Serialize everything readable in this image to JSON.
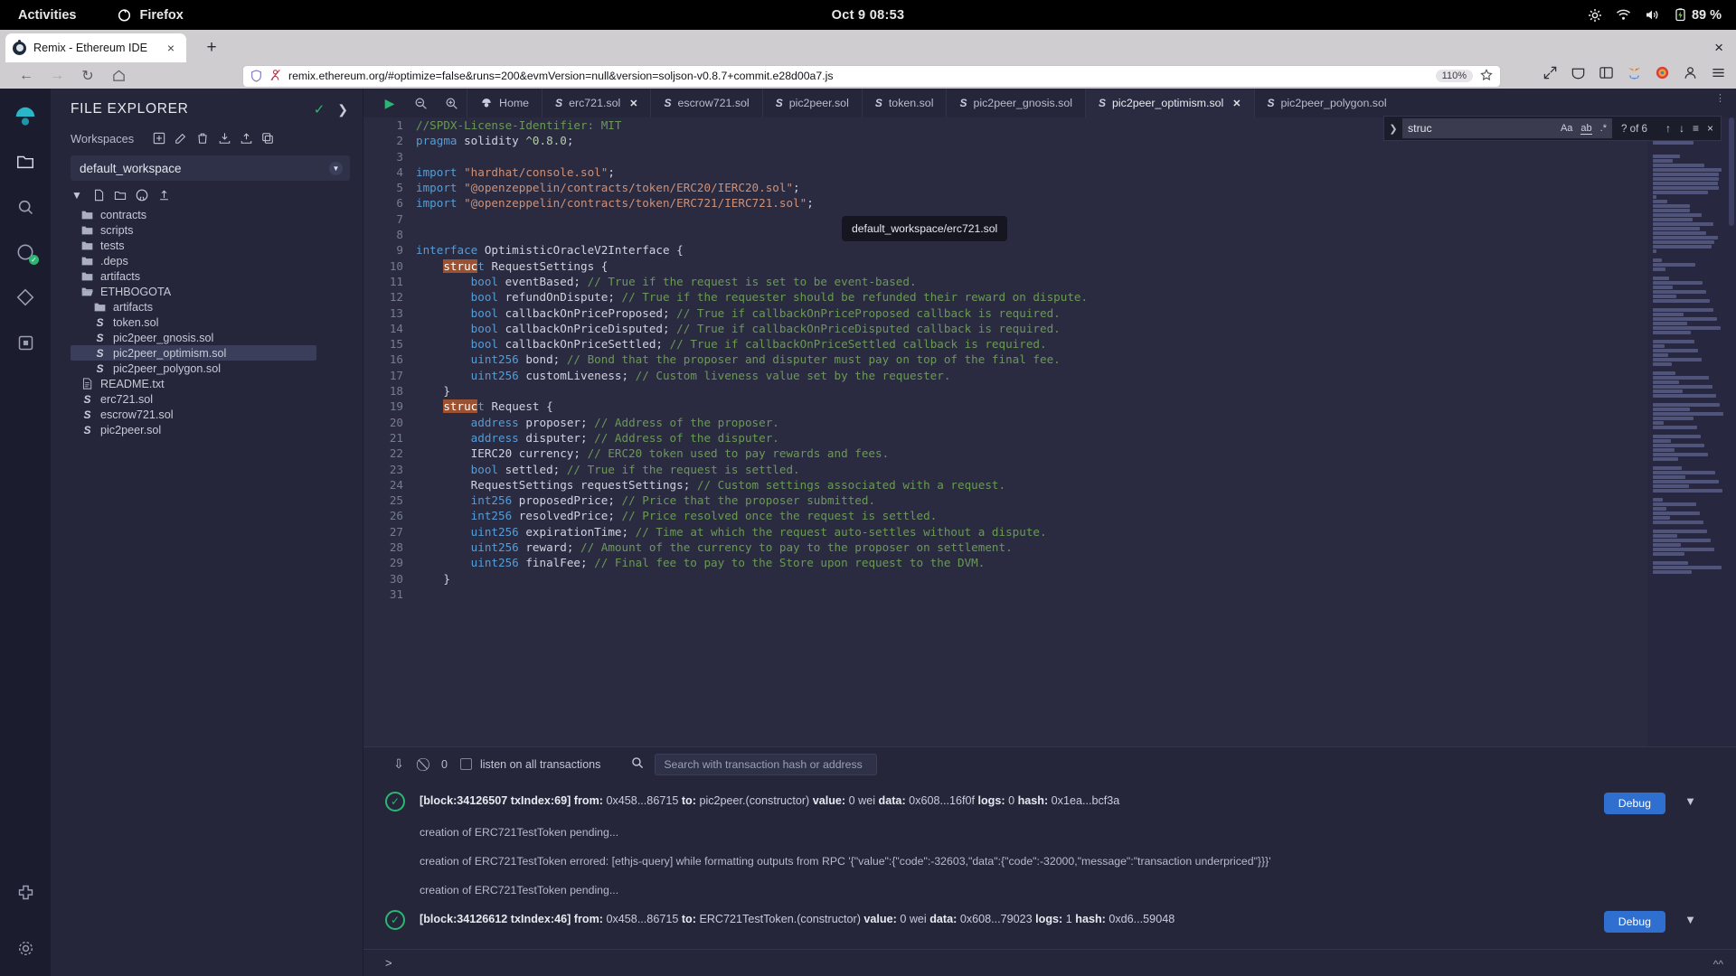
{
  "gnome": {
    "activities": "Activities",
    "app_name": "Firefox",
    "clock": "Oct 9  08:53",
    "battery": "89 %",
    "icons": [
      "settings-icon",
      "wifi-icon",
      "volume-icon",
      "battery-icon"
    ]
  },
  "browser": {
    "tab_title": "Remix - Ethereum IDE",
    "tab_close": "×",
    "new_tab": "+",
    "window_close": "×",
    "url": "remix.ethereum.org/#optimize=false&runs=200&evmVersion=null&version=soljson-v0.8.7+commit.e28d00a7.js",
    "zoom_level": "110%",
    "nav": {
      "back": "←",
      "forward": "→",
      "reload": "↻",
      "home": "⌂"
    }
  },
  "rail": {
    "items": [
      {
        "name": "remix-logo-icon",
        "glyph": "◉"
      },
      {
        "name": "file-explorer-icon",
        "glyph": "☰"
      },
      {
        "name": "search-icon",
        "glyph": "⌕"
      },
      {
        "name": "solidity-compiler-icon",
        "glyph": "⬢"
      },
      {
        "name": "deploy-run-icon",
        "glyph": "❖"
      },
      {
        "name": "debugger-icon",
        "glyph": "⬚"
      }
    ],
    "bottom": [
      {
        "name": "plugin-manager-icon",
        "glyph": "⬡"
      },
      {
        "name": "settings-gear-icon",
        "glyph": "⚙"
      }
    ]
  },
  "explorer": {
    "title": "FILE EXPLORER",
    "workspaces_label": "Workspaces",
    "workspace_actions": [
      "create-workspace-icon",
      "rename-workspace-icon",
      "delete-workspace-icon",
      "download-workspace-icon",
      "upload-workspace-icon",
      "duplicate-workspace-icon"
    ],
    "selected_workspace": "default_workspace",
    "tree_tools": [
      "new-file-icon",
      "new-folder-icon",
      "github-icon",
      "publish-icon"
    ],
    "tree": [
      {
        "label": "contracts",
        "type": "folder",
        "indent": 0,
        "selected": false
      },
      {
        "label": "scripts",
        "type": "folder",
        "indent": 0,
        "selected": false
      },
      {
        "label": "tests",
        "type": "folder",
        "indent": 0,
        "selected": false
      },
      {
        "label": ".deps",
        "type": "folder",
        "indent": 0,
        "selected": false
      },
      {
        "label": "artifacts",
        "type": "folder",
        "indent": 0,
        "selected": false
      },
      {
        "label": "ETHBOGOTA",
        "type": "folder-open",
        "indent": 0,
        "selected": false
      },
      {
        "label": "artifacts",
        "type": "folder",
        "indent": 1,
        "selected": false
      },
      {
        "label": "token.sol",
        "type": "sol",
        "indent": 1,
        "selected": false
      },
      {
        "label": "pic2peer_gnosis.sol",
        "type": "sol",
        "indent": 1,
        "selected": false
      },
      {
        "label": "pic2peer_optimism.sol",
        "type": "sol",
        "indent": 1,
        "selected": true
      },
      {
        "label": "pic2peer_polygon.sol",
        "type": "sol",
        "indent": 1,
        "selected": false
      },
      {
        "label": "README.txt",
        "type": "txt",
        "indent": 0,
        "selected": false
      },
      {
        "label": "erc721.sol",
        "type": "sol",
        "indent": 0,
        "selected": false
      },
      {
        "label": "escrow721.sol",
        "type": "sol",
        "indent": 0,
        "selected": false
      },
      {
        "label": "pic2peer.sol",
        "type": "sol",
        "indent": 0,
        "selected": false
      }
    ]
  },
  "editor": {
    "toolbar_icons": [
      "run-script-icon",
      "zoom-out-icon",
      "zoom-in-icon"
    ],
    "home_tab": "Home",
    "tabs": [
      {
        "label": "erc721.sol",
        "active": false,
        "closable": true
      },
      {
        "label": "escrow721.sol",
        "active": false,
        "closable": false
      },
      {
        "label": "pic2peer.sol",
        "active": false,
        "closable": false
      },
      {
        "label": "token.sol",
        "active": false,
        "closable": false
      },
      {
        "label": "pic2peer_gnosis.sol",
        "active": false,
        "closable": false
      },
      {
        "label": "pic2peer_optimism.sol",
        "active": true,
        "closable": true
      },
      {
        "label": "pic2peer_polygon.sol",
        "active": false,
        "closable": false
      }
    ],
    "tooltip": "default_workspace/erc721.sol",
    "find": {
      "query": "struc",
      "match_case": "Aa",
      "whole_word": "ab",
      "regex": ".*",
      "count": "? of 6",
      "prev": "↑",
      "next": "↓",
      "find_all": "≡",
      "close": "×"
    },
    "lines": [
      {
        "n": 1,
        "tokens": [
          {
            "t": "//SPDX-License-Identifier: MIT",
            "c": "cmt"
          }
        ]
      },
      {
        "n": 2,
        "tokens": [
          {
            "t": "pragma",
            "c": "kblue"
          },
          {
            "t": " solidity ",
            "c": "pl"
          },
          {
            "t": "^0.8.0",
            "c": "num"
          },
          {
            "t": ";",
            "c": "pl"
          }
        ]
      },
      {
        "n": 3,
        "tokens": []
      },
      {
        "n": 4,
        "tokens": [
          {
            "t": "import",
            "c": "kblue"
          },
          {
            "t": " ",
            "c": "pl"
          },
          {
            "t": "\"hardhat/console.sol\"",
            "c": "str"
          },
          {
            "t": ";",
            "c": "pl"
          }
        ]
      },
      {
        "n": 5,
        "tokens": [
          {
            "t": "import",
            "c": "kblue"
          },
          {
            "t": " ",
            "c": "pl"
          },
          {
            "t": "\"@openzeppelin/contracts/token/ERC20/IERC20.sol\"",
            "c": "str"
          },
          {
            "t": ";",
            "c": "pl"
          }
        ]
      },
      {
        "n": 6,
        "tokens": [
          {
            "t": "import",
            "c": "kblue"
          },
          {
            "t": " ",
            "c": "pl"
          },
          {
            "t": "\"@openzeppelin/contracts/token/ERC721/IERC721.sol\"",
            "c": "str"
          },
          {
            "t": ";",
            "c": "pl"
          }
        ]
      },
      {
        "n": 7,
        "tokens": []
      },
      {
        "n": 8,
        "tokens": []
      },
      {
        "n": 9,
        "tokens": [
          {
            "t": "interface",
            "c": "kblue"
          },
          {
            "t": " OptimisticOracleV2Interface {",
            "c": "pl"
          }
        ]
      },
      {
        "n": 10,
        "tokens": [
          {
            "t": "    ",
            "c": "pl"
          },
          {
            "t": "struc",
            "c": "hl"
          },
          {
            "t": "t",
            "c": "kblue"
          },
          {
            "t": " RequestSettings {",
            "c": "pl"
          }
        ]
      },
      {
        "n": 11,
        "tokens": [
          {
            "t": "        ",
            "c": "pl"
          },
          {
            "t": "bool",
            "c": "kblue"
          },
          {
            "t": " eventBased; ",
            "c": "pl"
          },
          {
            "t": "// True if the request is set to be event-based.",
            "c": "cmt"
          }
        ]
      },
      {
        "n": 12,
        "tokens": [
          {
            "t": "        ",
            "c": "pl"
          },
          {
            "t": "bool",
            "c": "kblue"
          },
          {
            "t": " refundOnDispute; ",
            "c": "pl"
          },
          {
            "t": "// True if the requester should be refunded their reward on dispute.",
            "c": "cmt"
          }
        ]
      },
      {
        "n": 13,
        "tokens": [
          {
            "t": "        ",
            "c": "pl"
          },
          {
            "t": "bool",
            "c": "kblue"
          },
          {
            "t": " callbackOnPriceProposed; ",
            "c": "pl"
          },
          {
            "t": "// True if callbackOnPriceProposed callback is required.",
            "c": "cmt"
          }
        ]
      },
      {
        "n": 14,
        "tokens": [
          {
            "t": "        ",
            "c": "pl"
          },
          {
            "t": "bool",
            "c": "kblue"
          },
          {
            "t": " callbackOnPriceDisputed; ",
            "c": "pl"
          },
          {
            "t": "// True if callbackOnPriceDisputed callback is required.",
            "c": "cmt"
          }
        ]
      },
      {
        "n": 15,
        "tokens": [
          {
            "t": "        ",
            "c": "pl"
          },
          {
            "t": "bool",
            "c": "kblue"
          },
          {
            "t": " callbackOnPriceSettled; ",
            "c": "pl"
          },
          {
            "t": "// True if callbackOnPriceSettled callback is required.",
            "c": "cmt"
          }
        ]
      },
      {
        "n": 16,
        "tokens": [
          {
            "t": "        ",
            "c": "pl"
          },
          {
            "t": "uint256",
            "c": "kblue"
          },
          {
            "t": " bond; ",
            "c": "pl"
          },
          {
            "t": "// Bond that the proposer and disputer must pay on top of the final fee.",
            "c": "cmt"
          }
        ]
      },
      {
        "n": 17,
        "tokens": [
          {
            "t": "        ",
            "c": "pl"
          },
          {
            "t": "uint256",
            "c": "kblue"
          },
          {
            "t": " customLiveness; ",
            "c": "pl"
          },
          {
            "t": "// Custom liveness value set by the requester.",
            "c": "cmt"
          }
        ]
      },
      {
        "n": 18,
        "tokens": [
          {
            "t": "    }",
            "c": "pl"
          }
        ]
      },
      {
        "n": 19,
        "tokens": [
          {
            "t": "    ",
            "c": "pl"
          },
          {
            "t": "struc",
            "c": "hl"
          },
          {
            "t": "t",
            "c": "kblue"
          },
          {
            "t": " Request {",
            "c": "pl"
          }
        ]
      },
      {
        "n": 20,
        "tokens": [
          {
            "t": "        ",
            "c": "pl"
          },
          {
            "t": "address",
            "c": "kblue"
          },
          {
            "t": " proposer; ",
            "c": "pl"
          },
          {
            "t": "// Address of the proposer.",
            "c": "cmt"
          }
        ]
      },
      {
        "n": 21,
        "tokens": [
          {
            "t": "        ",
            "c": "pl"
          },
          {
            "t": "address",
            "c": "kblue"
          },
          {
            "t": " disputer; ",
            "c": "pl"
          },
          {
            "t": "// Address of the disputer.",
            "c": "cmt"
          }
        ]
      },
      {
        "n": 22,
        "tokens": [
          {
            "t": "        IERC20 currency; ",
            "c": "pl"
          },
          {
            "t": "// ERC20 token used to pay rewards and fees.",
            "c": "cmt"
          }
        ]
      },
      {
        "n": 23,
        "tokens": [
          {
            "t": "        ",
            "c": "pl"
          },
          {
            "t": "bool",
            "c": "kblue"
          },
          {
            "t": " settled; ",
            "c": "pl"
          },
          {
            "t": "// True if the request is settled.",
            "c": "cmt"
          }
        ]
      },
      {
        "n": 24,
        "tokens": [
          {
            "t": "        RequestSettings requestSettings; ",
            "c": "pl"
          },
          {
            "t": "// Custom settings associated with a request.",
            "c": "cmt"
          }
        ]
      },
      {
        "n": 25,
        "tokens": [
          {
            "t": "        ",
            "c": "pl"
          },
          {
            "t": "int256",
            "c": "kblue"
          },
          {
            "t": " proposedPrice; ",
            "c": "pl"
          },
          {
            "t": "// Price that the proposer submitted.",
            "c": "cmt"
          }
        ]
      },
      {
        "n": 26,
        "tokens": [
          {
            "t": "        ",
            "c": "pl"
          },
          {
            "t": "int256",
            "c": "kblue"
          },
          {
            "t": " resolvedPrice; ",
            "c": "pl"
          },
          {
            "t": "// Price resolved once the request is settled.",
            "c": "cmt"
          }
        ]
      },
      {
        "n": 27,
        "tokens": [
          {
            "t": "        ",
            "c": "pl"
          },
          {
            "t": "uint256",
            "c": "kblue"
          },
          {
            "t": " expirationTime; ",
            "c": "pl"
          },
          {
            "t": "// Time at which the request auto-settles without a dispute.",
            "c": "cmt"
          }
        ]
      },
      {
        "n": 28,
        "tokens": [
          {
            "t": "        ",
            "c": "pl"
          },
          {
            "t": "uint256",
            "c": "kblue"
          },
          {
            "t": " reward; ",
            "c": "pl"
          },
          {
            "t": "// Amount of the currency to pay to the proposer on settlement.",
            "c": "cmt"
          }
        ]
      },
      {
        "n": 29,
        "tokens": [
          {
            "t": "        ",
            "c": "pl"
          },
          {
            "t": "uint256",
            "c": "kblue"
          },
          {
            "t": " finalFee; ",
            "c": "pl"
          },
          {
            "t": "// Final fee to pay to the Store upon request to the DVM.",
            "c": "cmt"
          }
        ]
      },
      {
        "n": 30,
        "tokens": [
          {
            "t": "    }",
            "c": "pl"
          }
        ]
      },
      {
        "n": 31,
        "tokens": []
      }
    ]
  },
  "terminal": {
    "pending_count": "0",
    "listen_label": "listen on all transactions",
    "search_placeholder": "Search with transaction hash or address",
    "toolbar_icons": [
      "collapse-icon",
      "clear-console-icon",
      "search-icon"
    ],
    "entries": [
      {
        "kind": "tx",
        "status": "success",
        "segments": [
          {
            "t": "[block:34126507 txIndex:69]",
            "b": true
          },
          {
            "t": " from: ",
            "b": true
          },
          {
            "t": "0x458...86715",
            "b": false
          },
          {
            "t": " to: ",
            "b": true
          },
          {
            "t": "pic2peer.(constructor)",
            "b": false
          },
          {
            "t": " value: ",
            "b": true
          },
          {
            "t": "0 wei",
            "b": false
          },
          {
            "t": " data: ",
            "b": true
          },
          {
            "t": "0x608...16f0f",
            "b": false
          },
          {
            "t": " logs: ",
            "b": true
          },
          {
            "t": "0",
            "b": false
          },
          {
            "t": " hash: ",
            "b": true
          },
          {
            "t": "0x1ea...bcf3a",
            "b": false
          }
        ],
        "debug_label": "Debug"
      },
      {
        "kind": "plain",
        "text": "creation of ERC721TestToken pending..."
      },
      {
        "kind": "plain",
        "text": "creation of ERC721TestToken errored: [ethjs-query] while formatting outputs from RPC '{\"value\":{\"code\":-32603,\"data\":{\"code\":-32000,\"message\":\"transaction underpriced\"}}}'"
      },
      {
        "kind": "plain",
        "text": "creation of ERC721TestToken pending..."
      },
      {
        "kind": "tx",
        "status": "success",
        "segments": [
          {
            "t": "[block:34126612 txIndex:46]",
            "b": true
          },
          {
            "t": " from: ",
            "b": true
          },
          {
            "t": "0x458...86715",
            "b": false
          },
          {
            "t": " to: ",
            "b": true
          },
          {
            "t": "ERC721TestToken.(constructor)",
            "b": false
          },
          {
            "t": " value: ",
            "b": true
          },
          {
            "t": "0 wei",
            "b": false
          },
          {
            "t": " data: ",
            "b": true
          },
          {
            "t": "0x608...79023",
            "b": false
          },
          {
            "t": " logs: ",
            "b": true
          },
          {
            "t": "1",
            "b": false
          },
          {
            "t": " hash: ",
            "b": true
          },
          {
            "t": "0xd6...59048",
            "b": false
          }
        ],
        "debug_label": "Debug"
      }
    ],
    "prompt": ">"
  }
}
